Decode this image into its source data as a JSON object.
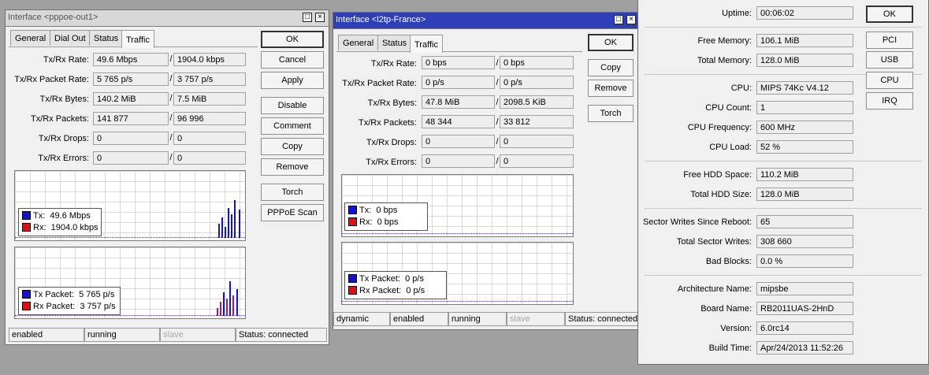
{
  "win1": {
    "title": "Interface <pppoe-out1>",
    "tabs": [
      "General",
      "Dial Out",
      "Status",
      "Traffic"
    ],
    "rows": [
      {
        "label": "Tx/Rx Rate:",
        "tx": "49.6 Mbps",
        "rx": "1904.0 kbps"
      },
      {
        "label": "Tx/Rx Packet Rate:",
        "tx": "5 765 p/s",
        "rx": "3 757 p/s"
      },
      {
        "label": "Tx/Rx Bytes:",
        "tx": "140.2 MiB",
        "rx": "7.5 MiB"
      },
      {
        "label": "Tx/Rx Packets:",
        "tx": "141 877",
        "rx": "96 996"
      },
      {
        "label": "Tx/Rx Drops:",
        "tx": "0",
        "rx": "0"
      },
      {
        "label": "Tx/Rx Errors:",
        "tx": "0",
        "rx": "0"
      }
    ],
    "buttons": [
      "OK",
      "Cancel",
      "Apply",
      "Disable",
      "Comment",
      "Copy",
      "Remove",
      "Torch",
      "PPPoE Scan"
    ],
    "graph1_legend": [
      {
        "label": "Tx:",
        "value": "49.6 Mbps"
      },
      {
        "label": "Rx:",
        "value": "1904.0 kbps"
      }
    ],
    "graph2_legend": [
      {
        "label": "Tx Packet:",
        "value": "5 765 p/s"
      },
      {
        "label": "Rx Packet:",
        "value": "3 757 p/s"
      }
    ],
    "status": [
      "enabled",
      "running",
      "slave",
      "Status: connected"
    ]
  },
  "win2": {
    "title": "Interface <l2tp-France>",
    "tabs": [
      "General",
      "Status",
      "Traffic"
    ],
    "rows": [
      {
        "label": "Tx/Rx Rate:",
        "tx": "0 bps",
        "rx": "0 bps"
      },
      {
        "label": "Tx/Rx Packet Rate:",
        "tx": "0 p/s",
        "rx": "0 p/s"
      },
      {
        "label": "Tx/Rx Bytes:",
        "tx": "47.8 MiB",
        "rx": "2098.5 KiB"
      },
      {
        "label": "Tx/Rx Packets:",
        "tx": "48 344",
        "rx": "33 812"
      },
      {
        "label": "Tx/Rx Drops:",
        "tx": "0",
        "rx": "0"
      },
      {
        "label": "Tx/Rx Errors:",
        "tx": "0",
        "rx": "0"
      }
    ],
    "buttons": [
      "OK",
      "Copy",
      "Remove",
      "Torch"
    ],
    "graph1_legend": [
      {
        "label": "Tx:",
        "value": "0 bps"
      },
      {
        "label": "Rx:",
        "value": "0 bps"
      }
    ],
    "graph2_legend": [
      {
        "label": "Tx Packet:",
        "value": "0 p/s"
      },
      {
        "label": "Rx Packet:",
        "value": "0 p/s"
      }
    ],
    "status": [
      "dynamic",
      "enabled",
      "running",
      "slave",
      "Status: connected"
    ]
  },
  "resources": {
    "rows": [
      {
        "label": "Uptime:",
        "value": "00:06:02"
      },
      {
        "label": "Free Memory:",
        "value": "106.1 MiB"
      },
      {
        "label": "Total Memory:",
        "value": "128.0 MiB"
      },
      {
        "label": "CPU:",
        "value": "MIPS 74Kc V4.12"
      },
      {
        "label": "CPU Count:",
        "value": "1"
      },
      {
        "label": "CPU Frequency:",
        "value": "600 MHz"
      },
      {
        "label": "CPU Load:",
        "value": "52 %"
      },
      {
        "label": "Free HDD Space:",
        "value": "110.2 MiB"
      },
      {
        "label": "Total HDD Size:",
        "value": "128.0 MiB"
      },
      {
        "label": "Sector Writes Since Reboot:",
        "value": "65"
      },
      {
        "label": "Total Sector Writes:",
        "value": "308 660"
      },
      {
        "label": "Bad Blocks:",
        "value": "0.0 %"
      },
      {
        "label": "Architecture Name:",
        "value": "mipsbe"
      },
      {
        "label": "Board Name:",
        "value": "RB2011UAS-2HnD"
      },
      {
        "label": "Version:",
        "value": "6.0rc14"
      },
      {
        "label": "Build Time:",
        "value": "Apr/24/2013 11:52:26"
      }
    ],
    "buttons": [
      "OK",
      "PCI",
      "USB",
      "CPU",
      "IRQ"
    ]
  },
  "colors": {
    "tx": "#1010e0",
    "rx": "#e01010",
    "title_active": "#2e3fb8"
  }
}
